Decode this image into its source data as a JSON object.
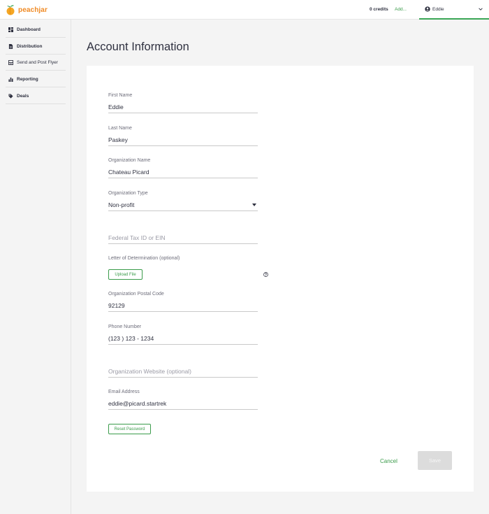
{
  "brand": {
    "name": "peachjar",
    "accent": "#f08a24",
    "green": "#3a9b4a"
  },
  "topbar": {
    "credits": "0 credits",
    "add_link": "Add...",
    "user_name": "Eddie"
  },
  "sidebar": {
    "items": [
      {
        "label": "Dashboard",
        "icon": "dashboard-icon"
      },
      {
        "label": "Distribution",
        "icon": "document-icon"
      },
      {
        "label": "Send and Post Flyer",
        "icon": "flyer-icon"
      },
      {
        "label": "Reporting",
        "icon": "bar-chart-icon"
      },
      {
        "label": "Deals",
        "icon": "tag-icon"
      }
    ]
  },
  "page": {
    "title": "Account Information"
  },
  "form": {
    "first_name": {
      "label": "First Name",
      "value": "Eddie"
    },
    "last_name": {
      "label": "Last Name",
      "value": "Paskey"
    },
    "org_name": {
      "label": "Organization Name",
      "value": "Chateau Picard"
    },
    "org_type": {
      "label": "Organization Type",
      "value": "Non-profit"
    },
    "tax_id": {
      "placeholder": "Federal Tax ID or EIN"
    },
    "letter": {
      "label": "Letter of Determination (optional)",
      "button": "Upload File"
    },
    "postal": {
      "label": "Organization Postal Code",
      "value": "92129"
    },
    "phone": {
      "label": "Phone Number",
      "value": "(123 ) 123 - 1234"
    },
    "website": {
      "placeholder": "Organization Website (optional)"
    },
    "email": {
      "label": "Email Address",
      "value": "eddie@picard.startrek"
    },
    "reset_password": "Reset Password",
    "cancel": "Cancel",
    "save": "Save"
  }
}
